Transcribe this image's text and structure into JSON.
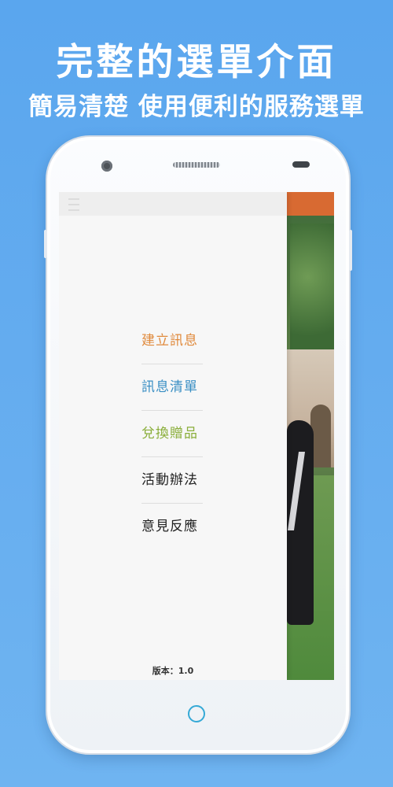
{
  "promo": {
    "headline": "完整的選單介面",
    "subline": "簡易清楚 使用便利的服務選單"
  },
  "drawer": {
    "menu_items": [
      {
        "label": "建立訊息",
        "color": "#e08a3c"
      },
      {
        "label": "訊息清單",
        "color": "#3a8fc4"
      },
      {
        "label": "兌換贈品",
        "color": "#8aae3a"
      },
      {
        "label": "活動辦法",
        "color": "#222222"
      },
      {
        "label": "意見反應",
        "color": "#222222"
      }
    ],
    "version_text": "版本：1.0"
  },
  "colors": {
    "background": "#64acef",
    "header_orange": "#d86a32",
    "home_button": "#35a9d6"
  },
  "icons": [
    "camera-icon",
    "speaker-grille",
    "proximity-sensor",
    "home-button",
    "hamburger-menu-icon"
  ]
}
